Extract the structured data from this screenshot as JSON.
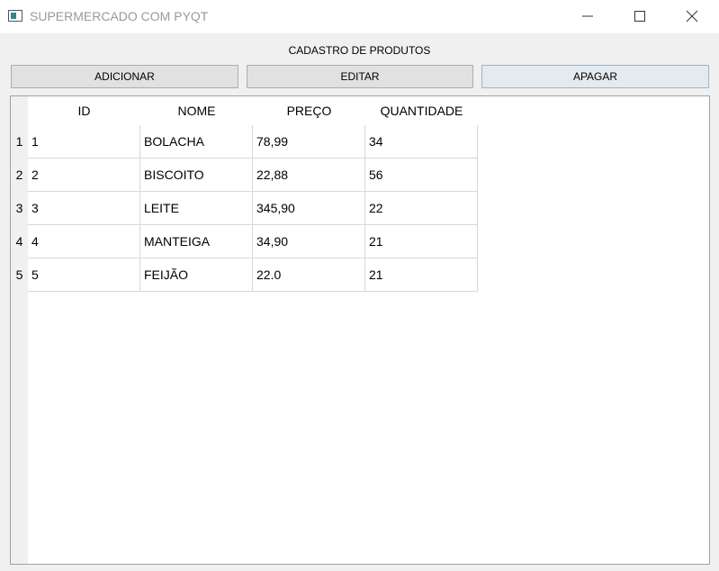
{
  "window": {
    "title": "SUPERMERCADO COM PYQT",
    "icon": "app-window-icon"
  },
  "form": {
    "title": "CADASTRO DE PRODUTOS"
  },
  "buttons": {
    "add": "ADICIONAR",
    "edit": "EDITAR",
    "delete": "APAGAR"
  },
  "table": {
    "columns": [
      "ID",
      "NOME",
      "PREÇO",
      "QUANTIDADE"
    ],
    "row_numbers": [
      "1",
      "2",
      "3",
      "4",
      "5"
    ],
    "rows": [
      [
        "1",
        "BOLACHA",
        "78,99",
        "34"
      ],
      [
        "2",
        "BISCOITO",
        "22,88",
        "56"
      ],
      [
        "3",
        "LEITE",
        "345,90",
        "22"
      ],
      [
        "4",
        "MANTEIGA",
        "34,90",
        "21"
      ],
      [
        "5",
        "FEIJÃO",
        "22.0",
        "21"
      ]
    ]
  }
}
